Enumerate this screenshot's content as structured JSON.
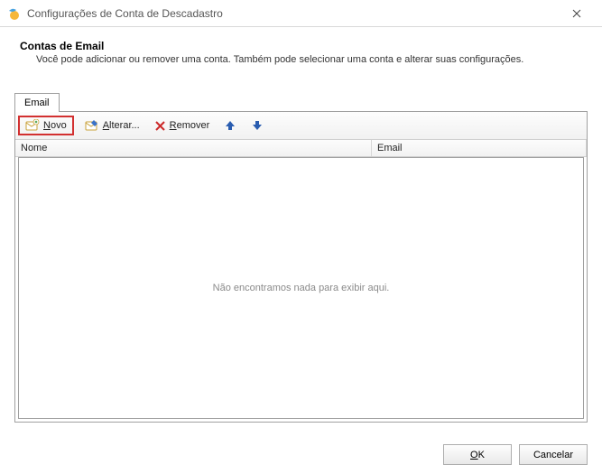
{
  "window": {
    "title": "Configurações de Conta de Descadastro"
  },
  "header": {
    "heading": "Contas de Email",
    "subheading": "Você pode adicionar ou remover uma conta. Também pode selecionar uma conta e alterar suas configurações."
  },
  "tab": {
    "label": "Email"
  },
  "toolbar": {
    "new_prefix": "N",
    "new_rest": "ovo",
    "change_prefix": "A",
    "change_rest": "lterar...",
    "remove_prefix": "R",
    "remove_rest": "emover"
  },
  "table": {
    "col_name": "Nome",
    "col_email": "Email",
    "empty": "Não encontramos nada para exibir aqui.",
    "rows": []
  },
  "buttons": {
    "ok_prefix": "O",
    "ok_rest": "K",
    "cancel": "Cancelar"
  }
}
